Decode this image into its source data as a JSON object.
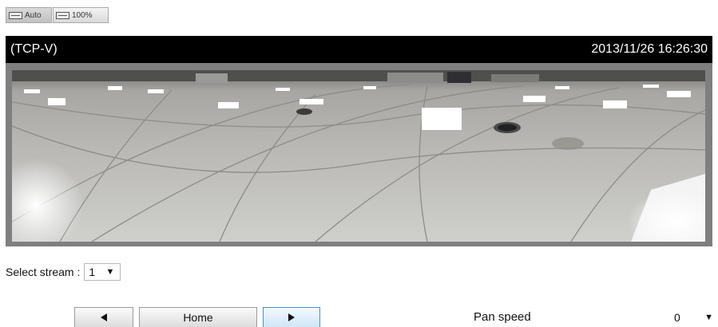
{
  "view_controls": {
    "auto_label": "Auto",
    "full_label": "100%"
  },
  "viewer": {
    "protocol_label": "(TCP-V)",
    "timestamp": "2013/11/26 16:26:30"
  },
  "stream": {
    "label": "Select stream :",
    "selected": "1"
  },
  "ptz": {
    "left_icon": "triangle-left-icon",
    "home_label": "Home",
    "right_icon": "triangle-right-icon"
  },
  "pan_speed": {
    "label": "Pan speed",
    "selected": "0"
  }
}
